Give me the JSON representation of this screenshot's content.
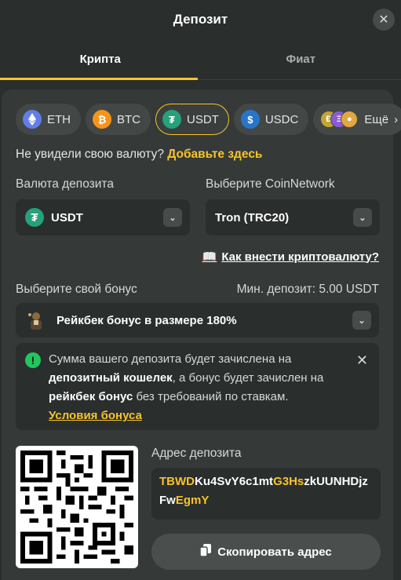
{
  "header": {
    "title": "Депозит",
    "close_icon": "close-icon"
  },
  "tabs": [
    {
      "label": "Крипта",
      "active": true
    },
    {
      "label": "Фиат",
      "active": false
    }
  ],
  "coins": [
    {
      "label": "ETH",
      "icon": "eth-icon",
      "color": "#627eea"
    },
    {
      "label": "BTC",
      "icon": "btc-icon",
      "color": "#f7931a"
    },
    {
      "label": "USDT",
      "icon": "usdt-icon",
      "color": "#26a17b",
      "active": true
    },
    {
      "label": "USDC",
      "icon": "usdc-icon",
      "color": "#2775ca"
    },
    {
      "label": "Ещё",
      "icon": "more-coins-icon"
    }
  ],
  "not_found": {
    "text": "Не увидели свою валюту?",
    "link": "Добавьте здесь"
  },
  "currency": {
    "label": "Валюта депозита",
    "value": "USDT"
  },
  "network": {
    "label": "Выберите CoinNetwork",
    "value": "Tron (TRC20)"
  },
  "howto": {
    "label": "Как внести криптовалюту?",
    "icon": "book-icon"
  },
  "bonus": {
    "label": "Выберите свой бонус",
    "min_deposit": "Мин. депозит: 5.00 USDT",
    "value": "Рейкбек бонус в размере 180%"
  },
  "notice": {
    "part1": "Сумма вашего депозита будет зачислена на ",
    "bold1": "депозитный кошелек",
    "part2": ", а бонус будет зачислен на ",
    "bold2": "рейкбек бонус",
    "part3": " без требований по ставкам.",
    "terms": "Условия бонуса"
  },
  "address": {
    "label": "Адрес депозита",
    "seg1": "TBWD",
    "seg2": "Ku4SvY6c1mt",
    "seg3": "G3Hs",
    "seg4": "zkUUNHDjzFw",
    "seg5": "EgmY"
  },
  "copy_button": "Скопировать адрес",
  "colors": {
    "accent": "#f8c32b",
    "panel": "#353a39",
    "background": "#2a2e2d",
    "success": "#22c55e"
  }
}
